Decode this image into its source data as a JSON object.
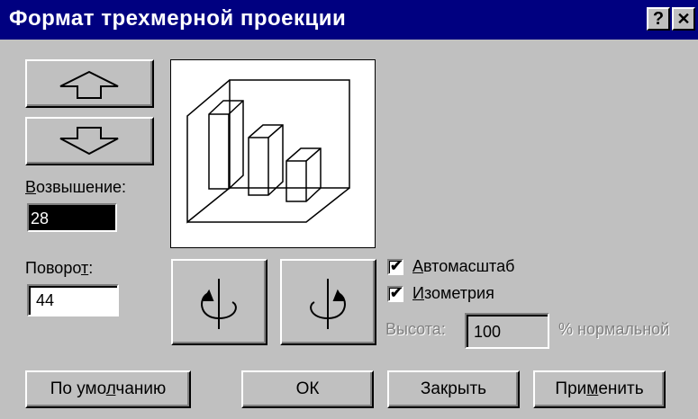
{
  "window": {
    "title": "Формат трехмерной проекции",
    "help_label": "?",
    "close_label": "✕"
  },
  "elevation": {
    "label_first": "В",
    "label_rest": "озвышение:",
    "value": "28"
  },
  "rotation": {
    "label_start": "Поворо",
    "label_underlined": "т",
    "label_end": ":",
    "value": "44"
  },
  "options": {
    "autoscale": {
      "underlined": "А",
      "rest": "втомасштаб",
      "checked": true
    },
    "isometric": {
      "underlined": "И",
      "rest": "зометрия",
      "checked": true
    },
    "height_label": "Высота:",
    "height_value": "100",
    "height_suffix": "% нормальной"
  },
  "buttons": {
    "default_start": "По умо",
    "default_underlined": "л",
    "default_end": "чанию",
    "ok": "ОК",
    "close": "Закрыть",
    "apply_start": "При",
    "apply_underlined": "м",
    "apply_end": "енить"
  },
  "icons": {
    "elevation_up": "arrow-up-icon",
    "elevation_down": "arrow-down-icon",
    "rotate_left": "rotate-counterclockwise-icon",
    "rotate_right": "rotate-clockwise-icon",
    "preview": "3d-column-chart-preview-icon"
  }
}
